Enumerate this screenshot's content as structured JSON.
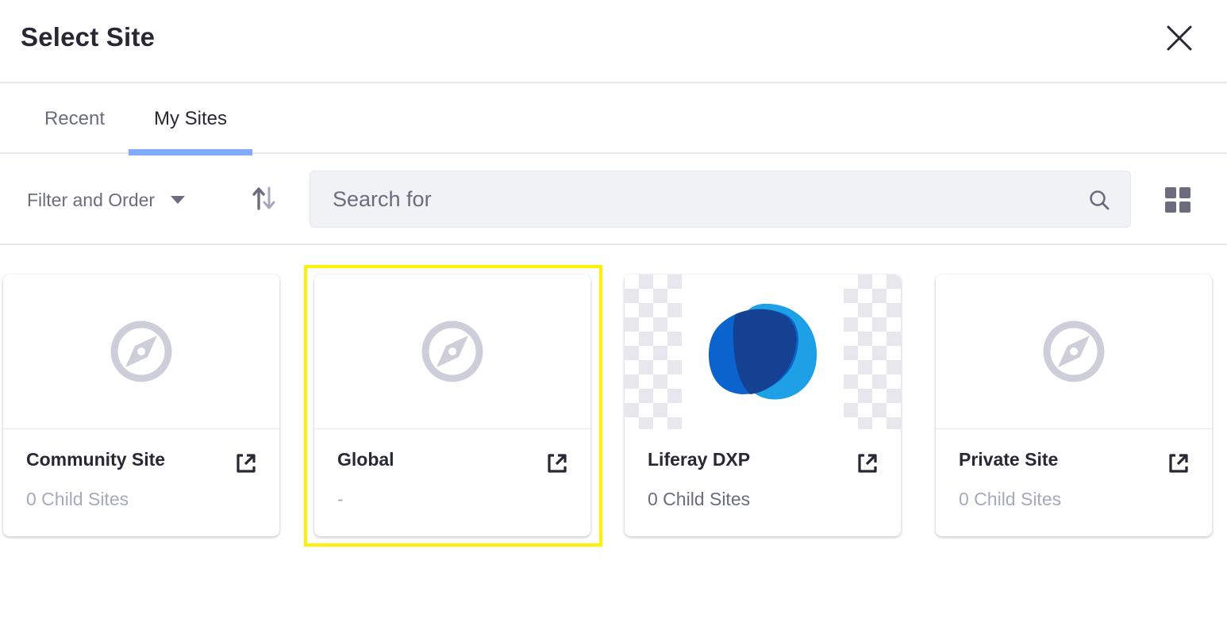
{
  "dialog": {
    "title": "Select Site",
    "close_icon": "close-icon"
  },
  "tabs": [
    {
      "label": "Recent",
      "active": false
    },
    {
      "label": "My Sites",
      "active": true
    }
  ],
  "toolbar": {
    "filter_label": "Filter and Order",
    "filter_icon": "caret-down-icon",
    "sort_icon": "order-arrows-icon",
    "search": {
      "placeholder": "Search for",
      "value": "",
      "icon": "search-icon"
    },
    "view_icon": "cards-grid-icon"
  },
  "colors": {
    "tab_indicator": "#80acff",
    "highlight": "#fff200",
    "text_primary": "#272833",
    "text_secondary": "#6b6c7e",
    "text_muted": "#a7a9bc",
    "placeholder_icon": "#cdced9",
    "logo_light": "#1ea0e6",
    "logo_mid": "#0b63ce",
    "logo_dark": "#154193"
  },
  "sites": [
    {
      "name": "Community Site",
      "subtitle": "0 Child Sites",
      "image": "compass-icon",
      "highlighted": false
    },
    {
      "name": "Global",
      "subtitle": "-",
      "image": "compass-icon",
      "highlighted": true
    },
    {
      "name": "Liferay DXP",
      "subtitle": "0 Child Sites",
      "image": "liferay-logo",
      "highlighted": false
    },
    {
      "name": "Private Site",
      "subtitle": "0 Child Sites",
      "image": "compass-icon",
      "highlighted": false
    }
  ]
}
